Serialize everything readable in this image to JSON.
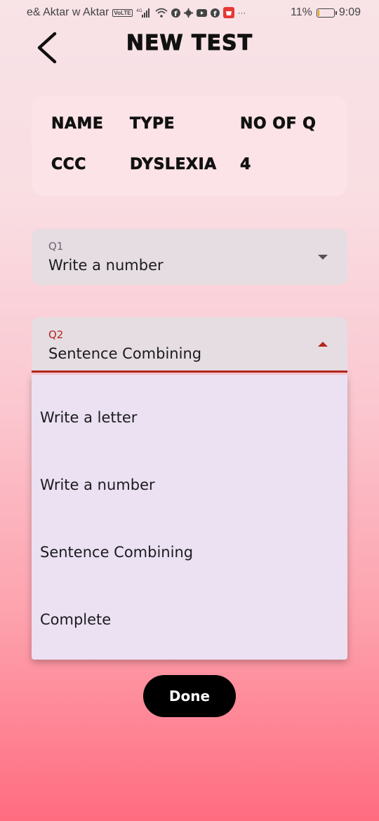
{
  "status_bar": {
    "carrier": "e& Aktar w Aktar",
    "network_badge": "VoLTE",
    "network_type": "4G",
    "battery_percent": "11%",
    "battery_level": 0.11,
    "time": "9:09",
    "icons": [
      "signal-icon",
      "wifi-icon",
      "facebook-icon",
      "gear-icon",
      "youtube-icon",
      "facebook-icon",
      "shop-icon",
      "more-icon"
    ]
  },
  "header": {
    "title": "NEW TEST"
  },
  "info": {
    "headers": [
      "NAME",
      "TYPE",
      "NO OF Q"
    ],
    "values": [
      "CCC",
      "DYSLEXIA",
      "4"
    ]
  },
  "questions": [
    {
      "label": "Q1",
      "value": "Write a number"
    },
    {
      "label": "Q2",
      "value": "Sentence Combining"
    }
  ],
  "menu": {
    "options": [
      "Write a letter",
      "Write a number",
      "Sentence Combining",
      "Complete"
    ]
  },
  "actions": {
    "done_label": "Done"
  },
  "colors": {
    "accent": "#b3261e",
    "button": "#000000"
  }
}
